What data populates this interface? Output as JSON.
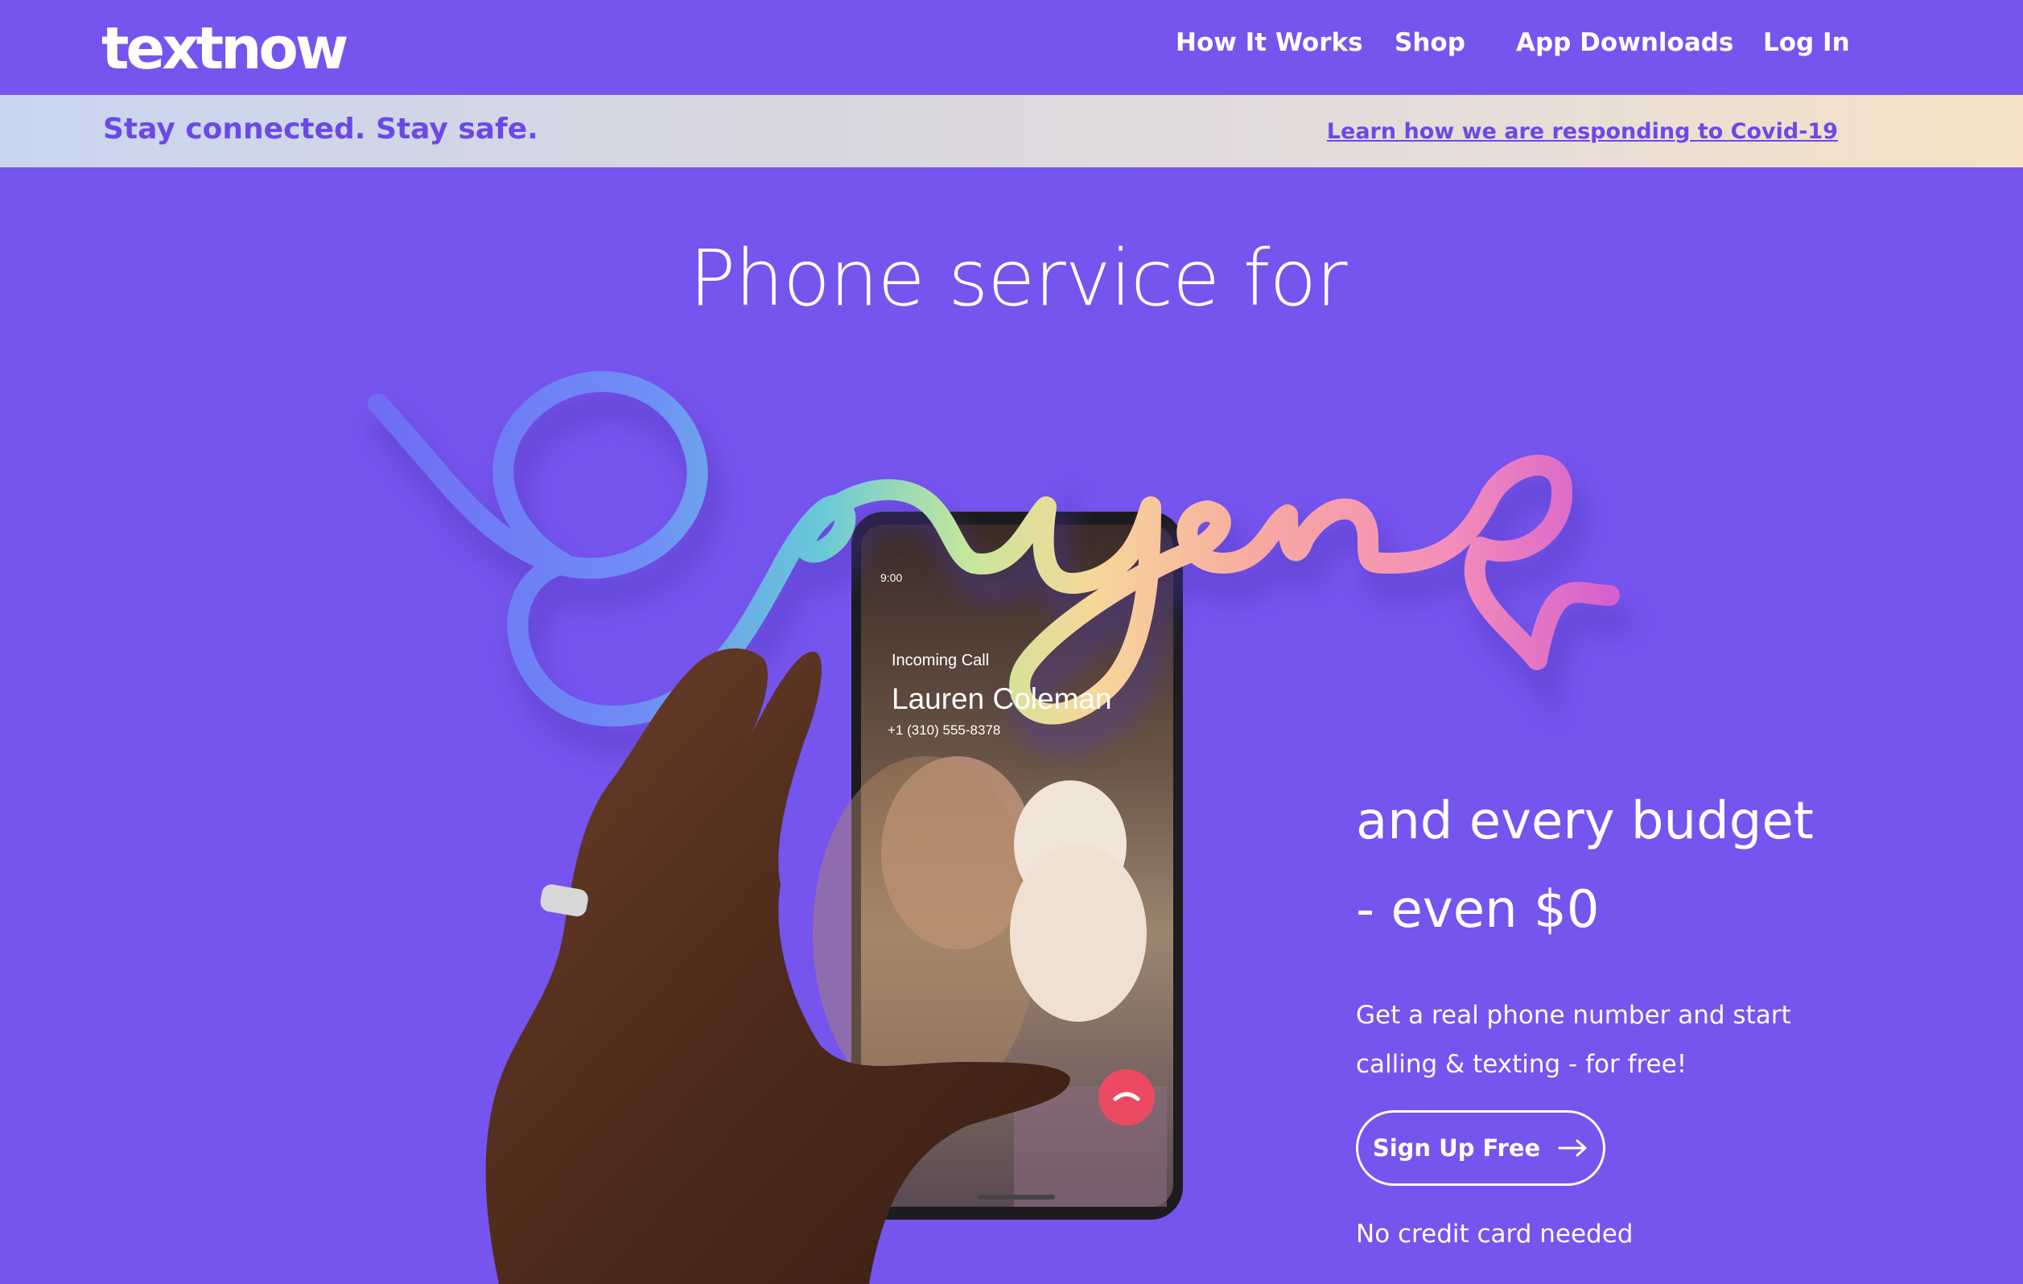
{
  "brand": {
    "logo": "textnow"
  },
  "nav": {
    "items": [
      {
        "label": "How It Works"
      },
      {
        "label": "Shop"
      },
      {
        "label": "App Downloads"
      },
      {
        "label": "Log In"
      }
    ]
  },
  "banner": {
    "message": "Stay connected. Stay safe.",
    "link": "Learn how we are responding to Covid-19"
  },
  "hero": {
    "headline": "Phone service for",
    "script_word": "Everyone",
    "subheading_line1": "and every budget",
    "subheading_line2": "- even $0",
    "description": "Get a real phone number and start calling & texting - for free!",
    "cta_label": "Sign Up Free",
    "note": "No credit card needed"
  },
  "phone": {
    "time": "9:00",
    "call_status": "Incoming Call",
    "caller_name": "Lauren Coleman",
    "caller_number": "+1 (310) 555-8378"
  },
  "colors": {
    "background": "#7654EE",
    "banner_text": "#6b49e8",
    "decline": "#ec4a63",
    "accept": "#3fbf7b"
  },
  "icons": [
    "arrow-right-icon",
    "phone-decline-icon",
    "phone-accept-icon",
    "signal-icon",
    "wifi-icon",
    "battery-icon"
  ]
}
